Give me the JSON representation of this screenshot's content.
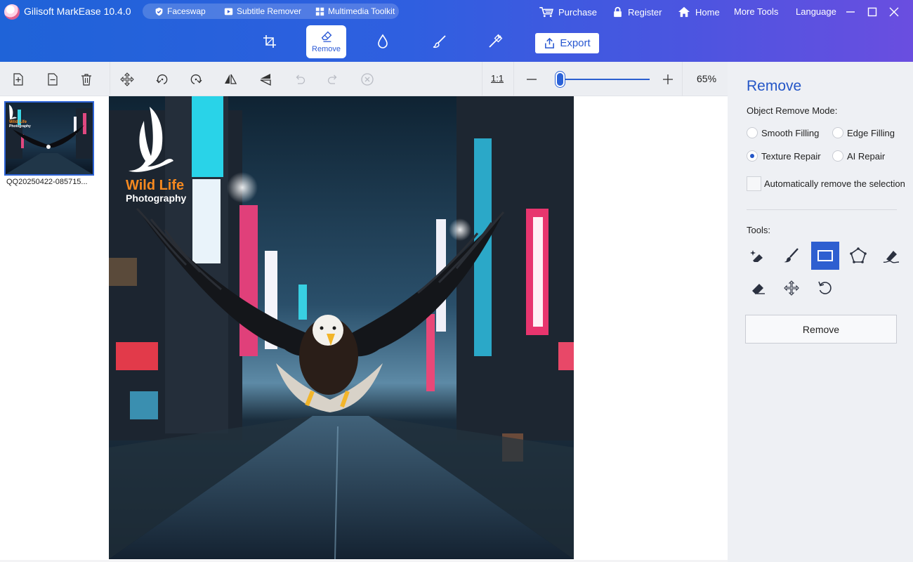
{
  "app": {
    "title": "Gilisoft MarkEase 10.4.0"
  },
  "pill": [
    {
      "label": "Faceswap",
      "icon": "shield-check-icon"
    },
    {
      "label": "Subtitle Remover",
      "icon": "play-icon"
    },
    {
      "label": "Multimedia Toolkit",
      "icon": "grid-icon"
    }
  ],
  "top_links": {
    "purchase": "Purchase",
    "register": "Register",
    "home": "Home",
    "more_tools": "More Tools",
    "language": "Language"
  },
  "mode_tabs": {
    "crop_icon": "crop-icon",
    "remove_label": "Remove",
    "droplet_icon": "droplet-icon",
    "brush_icon": "brush-icon",
    "wand_icon": "magic-wand-icon",
    "export_label": "Export"
  },
  "toolbar": {
    "zoom_reset": "1:1",
    "zoom_value": "65%",
    "zoom_fraction": 0.05
  },
  "thumbnail": {
    "caption": "QQ20250422-085715...",
    "watermark_line1": "Wild Life",
    "watermark_line2": "Photography"
  },
  "photo": {
    "watermark_line1": "Wild Life",
    "watermark_line2": "Photography"
  },
  "right_panel": {
    "title": "Remove",
    "mode_label": "Object Remove Mode:",
    "modes": [
      {
        "label": "Smooth Filling",
        "checked": false
      },
      {
        "label": "Edge Filling",
        "checked": false
      },
      {
        "label": "Texture Repair",
        "checked": true
      },
      {
        "label": "AI Repair",
        "checked": false
      }
    ],
    "auto_remove_label": "Automatically remove the selection",
    "tools_label": "Tools:",
    "remove_button": "Remove"
  },
  "colors": {
    "header_start": "#1f63d8",
    "header_end": "#6a4ee0",
    "accent": "#2456c7"
  }
}
